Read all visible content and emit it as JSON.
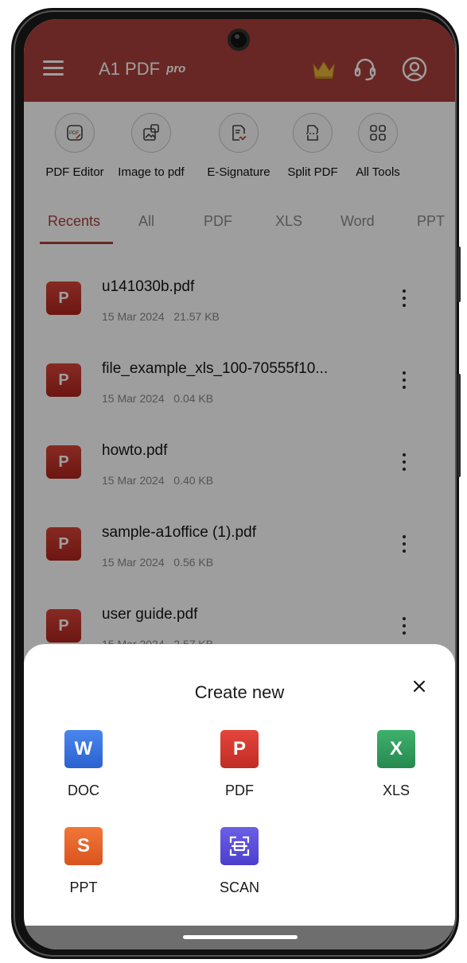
{
  "app": {
    "title": "A1 PDF",
    "title_suffix": "pro",
    "brand_color": "#a8403a",
    "top_icons": [
      "crown-icon",
      "headset-support-icon",
      "user-account-icon"
    ]
  },
  "tools": [
    {
      "label": "PDF Editor",
      "icon": "pdf-edit-icon"
    },
    {
      "label": "Image to pdf",
      "icon": "image-to-pdf-icon"
    },
    {
      "label": "E-Signature",
      "icon": "signature-icon"
    },
    {
      "label": "Split PDF",
      "icon": "split-pdf-icon"
    },
    {
      "label": "All Tools",
      "icon": "grid-icon"
    }
  ],
  "tabs": [
    {
      "label": "Recents",
      "active": true
    },
    {
      "label": "All",
      "active": false
    },
    {
      "label": "PDF",
      "active": false
    },
    {
      "label": "XLS",
      "active": false
    },
    {
      "label": "Word",
      "active": false
    },
    {
      "label": "PPT",
      "active": false
    }
  ],
  "files": [
    {
      "badge": "P",
      "name": "u141030b.pdf",
      "date": "15 Mar 2024",
      "size": "21.57 KB"
    },
    {
      "badge": "P",
      "name": "file_example_xls_100-70555f10...",
      "date": "15 Mar 2024",
      "size": "0.04 KB"
    },
    {
      "badge": "P",
      "name": "howto.pdf",
      "date": "15 Mar 2024",
      "size": "0.40 KB"
    },
    {
      "badge": "P",
      "name": "sample-a1office (1).pdf",
      "date": "15 Mar 2024",
      "size": "0.56 KB"
    },
    {
      "badge": "P",
      "name": "user guide.pdf",
      "date": "15 Mar 2024",
      "size": "2.57 KB"
    }
  ],
  "sheet": {
    "title": "Create new",
    "close_icon": "close-icon",
    "items": [
      {
        "letter": "W",
        "label": "DOC",
        "color": "#2f6fde"
      },
      {
        "letter": "P",
        "label": "PDF",
        "color": "#d13a33"
      },
      {
        "letter": "X",
        "label": "XLS",
        "color": "#2f9a5c"
      },
      {
        "letter": "S",
        "label": "PPT",
        "color": "#e8622c"
      },
      {
        "letter": "",
        "label": "SCAN",
        "color": "#5b4fd6",
        "icon": "scan-icon"
      }
    ]
  }
}
